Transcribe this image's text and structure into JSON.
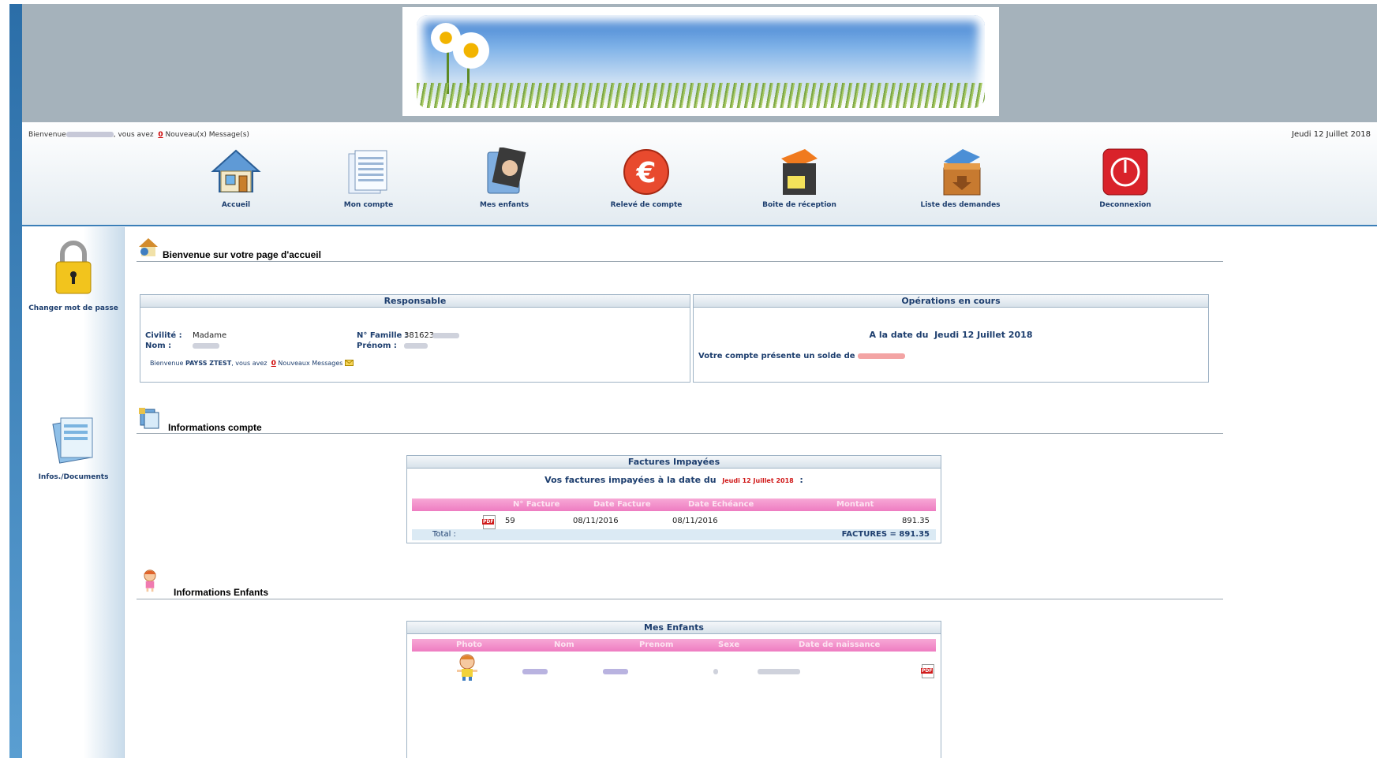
{
  "header": {
    "welcome_prefix": "Bienvenue",
    "welcome_mid": ", vous avez",
    "new_count": "0",
    "new_messages": "Nouveau(x) Message(s)",
    "date": "Jeudi 12 Juillet 2018"
  },
  "nav": [
    {
      "label": "Accueil",
      "icon": "home-icon"
    },
    {
      "label": "Mon compte",
      "icon": "documents-icon"
    },
    {
      "label": "Mes enfants",
      "icon": "child-photo-icon"
    },
    {
      "label": "Relevé de compte",
      "icon": "euro-icon"
    },
    {
      "label": "Boite de réception",
      "icon": "inbox-icon"
    },
    {
      "label": "Liste des demandes",
      "icon": "request-list-icon"
    },
    {
      "label": "Deconnexion",
      "icon": "power-icon"
    }
  ],
  "sidebar": {
    "change_password": "Changer mot de passe",
    "infos_documents": "Infos./Documents"
  },
  "welcome_section": {
    "title": "Bienvenue sur votre page d'accueil"
  },
  "responsable": {
    "heading": "Responsable",
    "civilite_label": "Civilité :",
    "civilite_value": "Madame",
    "nom_label": "Nom :",
    "famille_label": "N° Famille :",
    "famille_value": "381623",
    "prenom_label": "Prénom :",
    "bienvenue_prefix": "Bienvenue",
    "bienvenue_name": "PAYSS ZTEST",
    "bienvenue_mid": ", vous avez",
    "messages_count": "0",
    "messages_suffix": "Nouveaux Messages"
  },
  "operations": {
    "heading": "Opérations en cours",
    "date_prefix": "A la date du",
    "date": "Jeudi 12 Juillet 2018",
    "solde_text": "Votre compte présente un solde de"
  },
  "account_section": {
    "title": "Informations compte"
  },
  "factures": {
    "heading": "Factures Impayées",
    "subtitle": "Vos factures impayées à la date du",
    "date": "Jeudi 12 Juillet 2018",
    "colon": ":",
    "columns": [
      "N° Facture",
      "Date Facture",
      "Date Echéance",
      "Montant"
    ],
    "rows": [
      {
        "num": "59",
        "date_facture": "08/11/2016",
        "date_echeance": "08/11/2016",
        "montant": "891.35"
      }
    ],
    "total_label": "Total :",
    "total_value": "FACTURES = 891.35"
  },
  "children_section": {
    "title": "Informations Enfants"
  },
  "enfants": {
    "heading": "Mes Enfants",
    "columns": [
      "Photo",
      "Nom",
      "Prenom",
      "Sexe",
      "Date de naissance"
    ]
  }
}
